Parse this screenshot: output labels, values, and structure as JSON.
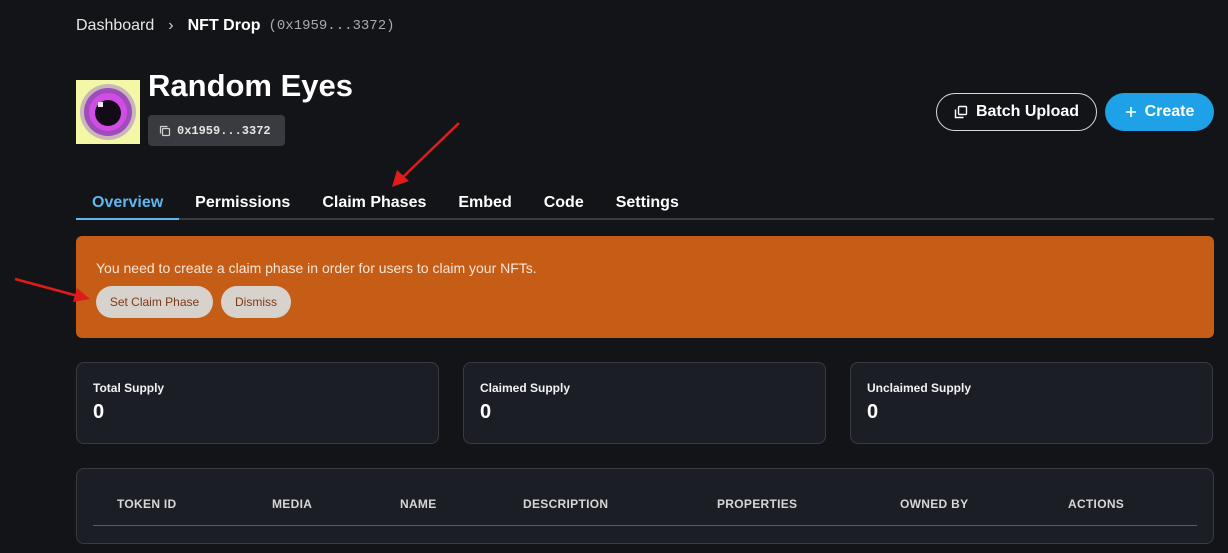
{
  "breadcrumb": {
    "root": "Dashboard",
    "separator": "›",
    "current": "NFT Drop",
    "address": "(0x1959...3372)"
  },
  "contract": {
    "name": "Random Eyes",
    "address": "0x1959...3372"
  },
  "actions": {
    "batch_upload": "Batch Upload",
    "create": "Create"
  },
  "tabs": [
    {
      "label": "Overview",
      "active": true
    },
    {
      "label": "Permissions"
    },
    {
      "label": "Claim Phases"
    },
    {
      "label": "Embed"
    },
    {
      "label": "Code"
    },
    {
      "label": "Settings"
    }
  ],
  "alert": {
    "message": "You need to create a claim phase in order for users to claim your NFTs.",
    "set_claim_phase": "Set Claim Phase",
    "dismiss": "Dismiss"
  },
  "stats": [
    {
      "label": "Total Supply",
      "value": "0"
    },
    {
      "label": "Claimed Supply",
      "value": "0"
    },
    {
      "label": "Unclaimed Supply",
      "value": "0"
    }
  ],
  "table": {
    "columns": [
      "TOKEN ID",
      "MEDIA",
      "NAME",
      "DESCRIPTION",
      "PROPERTIES",
      "OWNED BY",
      "ACTIONS"
    ]
  },
  "colors": {
    "background": "#131418",
    "accent": "#1ea1e6",
    "active_tab": "#61b6ef",
    "alert": "#c65d17",
    "annotation_arrow": "#e01b1b"
  }
}
